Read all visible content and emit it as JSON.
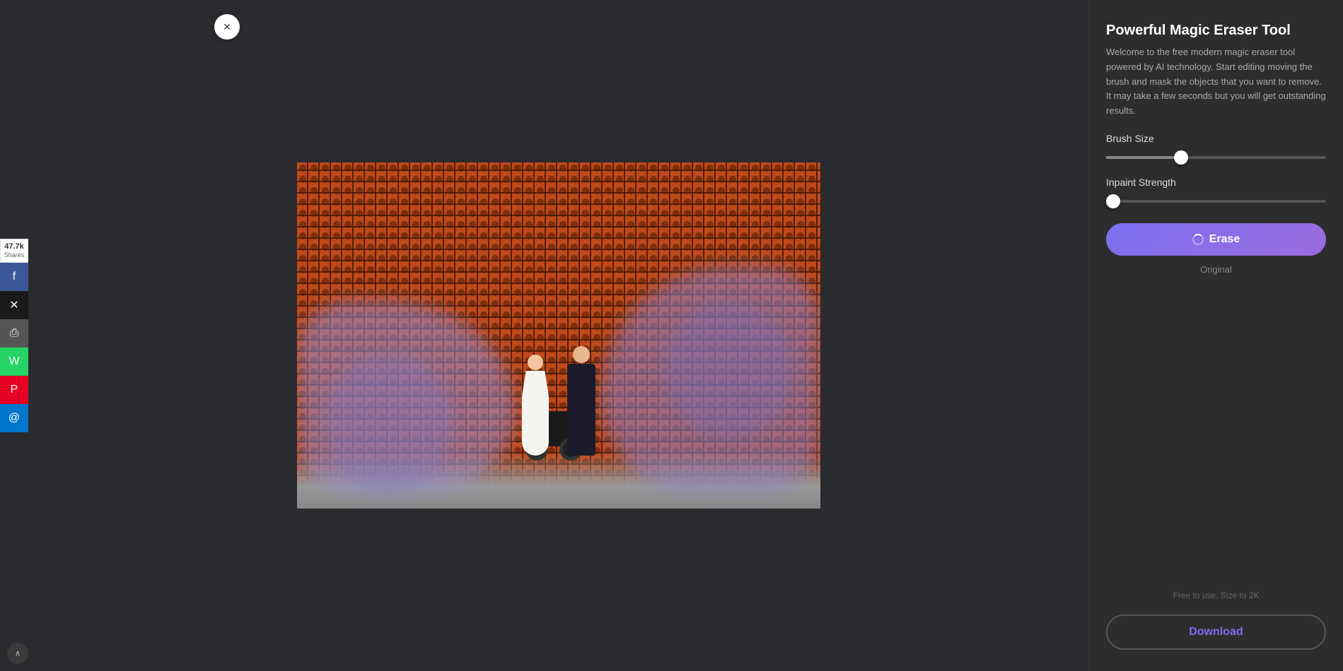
{
  "socialSidebar": {
    "shareCount": "47.7k",
    "sharesLabel": "Shares",
    "buttons": [
      {
        "id": "facebook",
        "icon": "f",
        "label": "Facebook",
        "class": "facebook"
      },
      {
        "id": "twitter",
        "icon": "✕",
        "label": "Twitter/X",
        "class": "twitter"
      },
      {
        "id": "print",
        "icon": "🖨",
        "label": "Print",
        "class": "print"
      },
      {
        "id": "whatsapp",
        "icon": "W",
        "label": "WhatsApp",
        "class": "whatsapp"
      },
      {
        "id": "pinterest",
        "icon": "P",
        "label": "Pinterest",
        "class": "pinterest"
      },
      {
        "id": "email",
        "icon": "@",
        "label": "Email",
        "class": "email"
      }
    ]
  },
  "panel": {
    "title": "Powerful Magic Eraser Tool",
    "description": "Welcome to the free modern magic eraser tool powered by AI technology. Start editing moving the brush and mask the objects that you want to remove. It may take a few seconds but you will get outstanding results.",
    "brushSize": {
      "label": "Brush Size",
      "value": 33,
      "min": 0,
      "max": 100
    },
    "inpaintStrength": {
      "label": "Inpaint Strength",
      "value": 0,
      "min": 0,
      "max": 100
    },
    "eraseButton": "Erase",
    "originalLink": "Original",
    "freeUseText": "Free to use. Size to 2K",
    "downloadButton": "Download"
  },
  "closeButton": "×",
  "scrollIndicator": "∧"
}
